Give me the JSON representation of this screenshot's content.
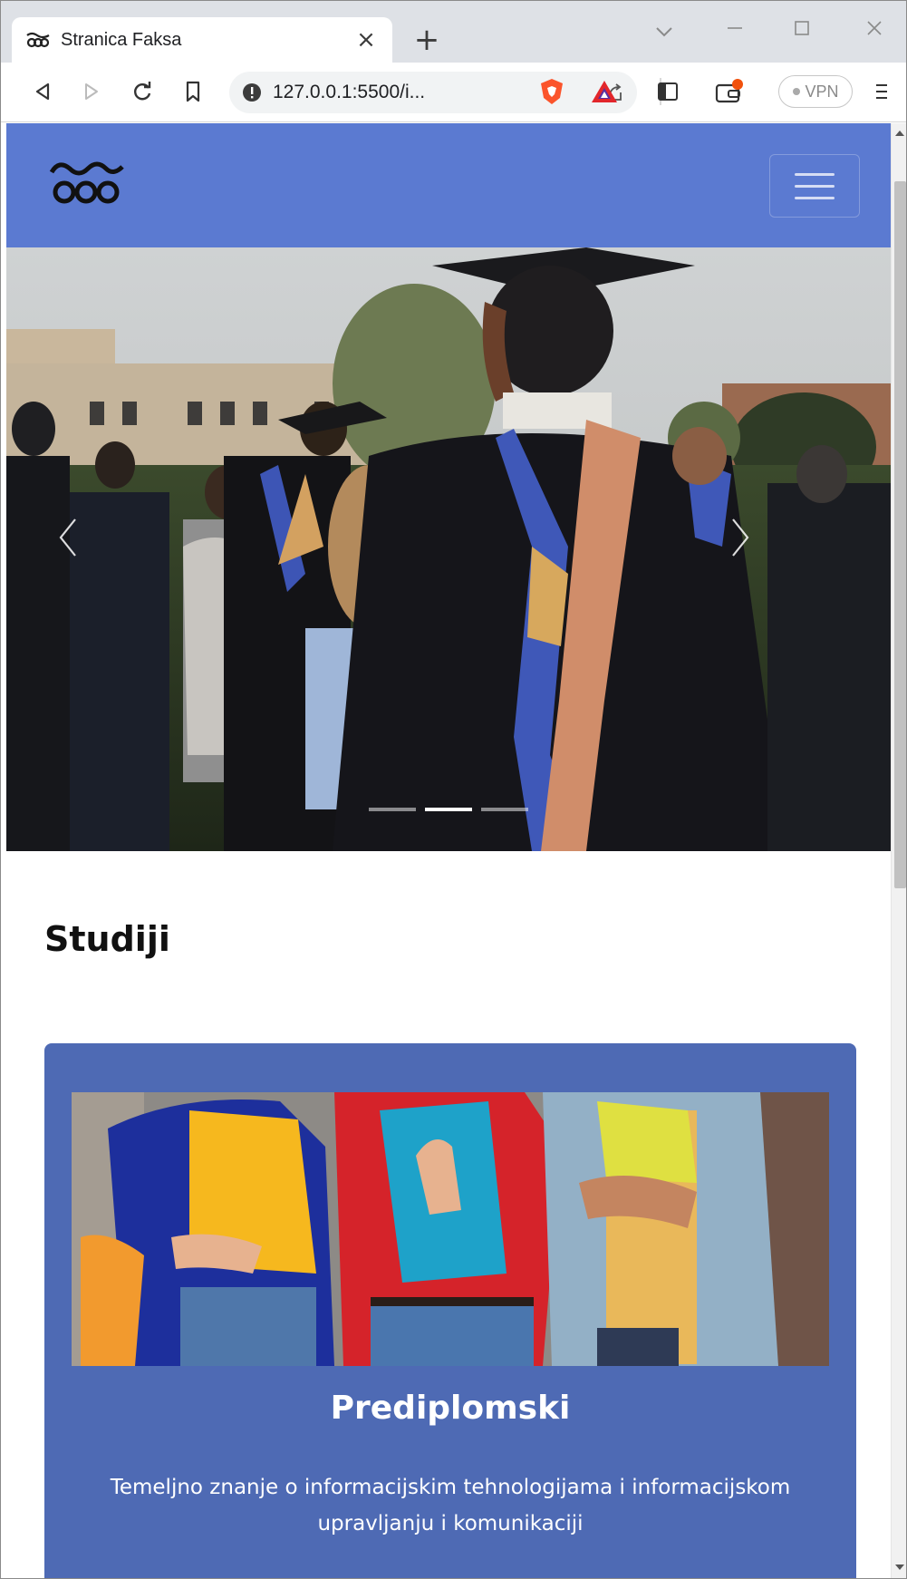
{
  "browser": {
    "tab_title": "Stranica Faksa",
    "tab_close": "×",
    "new_tab": "+",
    "url": "127.0.0.1:5500/i...",
    "vpn_label": "VPN",
    "icons": [
      "back-icon",
      "forward-icon",
      "reload-icon",
      "bookmark-icon",
      "info-icon",
      "share-icon",
      "brave-shield-icon",
      "brave-rewards-icon",
      "sidebar-icon",
      "wallet-icon",
      "menu-icon"
    ],
    "accent": "#5b7ad1"
  },
  "navbar": {
    "background": "#5b7ad1"
  },
  "carousel": {
    "slides": 3,
    "active_slide": 2
  },
  "section": {
    "title": "Studiji"
  },
  "card": {
    "title": "Prediplomski",
    "text": "Temeljno znanje o informacijskim tehnologijama i informacijskom upravljanju i komunikaciji",
    "background": "#4e6ab4"
  }
}
